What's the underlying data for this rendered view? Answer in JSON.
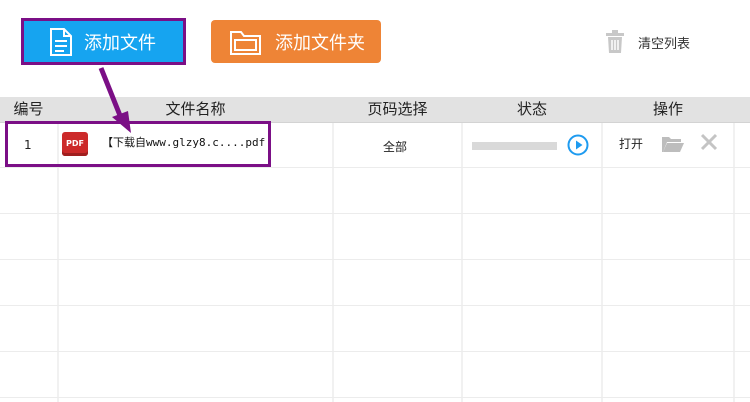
{
  "toolbar": {
    "add_file_label": "添加文件",
    "add_folder_label": "添加文件夹",
    "clear_list_label": "清空列表"
  },
  "table": {
    "columns": [
      "编号",
      "文件名称",
      "页码选择",
      "状态",
      "操作"
    ],
    "rows": [
      {
        "index": "1",
        "file_icon": "PDF",
        "file_name": "【下载自www.glzy8.c....pdf",
        "page_selection": "全部",
        "progress": 0,
        "open_label": "打开"
      }
    ]
  },
  "colors": {
    "add_file_bg": "#16a4f0",
    "add_folder_bg": "#ee8436",
    "highlight": "#7b0f86",
    "header_bg": "#e2e2e2",
    "play_blue": "#1e9bf0"
  },
  "icons": {
    "add_file": "document-icon",
    "add_folder": "folder-icon",
    "clear": "trash-icon",
    "play": "play-icon",
    "open_folder": "folder-open-icon",
    "remove": "close-icon",
    "file": "pdf-icon"
  }
}
